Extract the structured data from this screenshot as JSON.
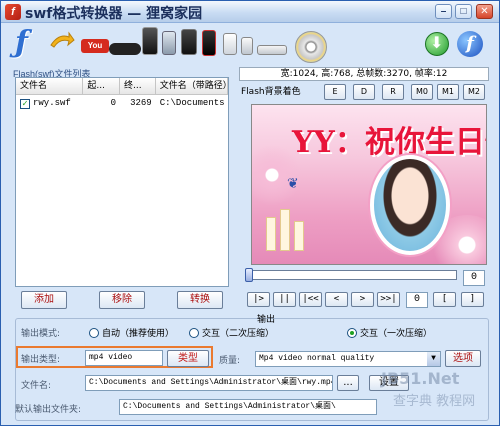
{
  "window": {
    "title": "swf格式转换器 — 狸窝家园",
    "app_icon_letter": "f",
    "controls": [
      "–",
      "□",
      "✕"
    ]
  },
  "toolbar": {
    "flash_letter": "ƒ",
    "youtube_label": "You",
    "round_flash_letter": "f",
    "icons": [
      "flash-icon",
      "arrow-icon",
      "youtube-icon",
      "psp-icon",
      "iphone-icon",
      "phone-icon",
      "ipod-icon",
      "walkman-icon",
      "ipod-classic-icon",
      "player-icon",
      "dvd-icon",
      "download-icon",
      "flash-help-icon"
    ]
  },
  "file_list": {
    "caption": "Flash(swf)文件列表",
    "headers": [
      "文件名",
      "起...",
      "终...",
      "文件名（带路径）"
    ],
    "rows": [
      {
        "name": "rwy.swf",
        "start": "0",
        "end": "3269",
        "path": "C:\\Documents"
      }
    ]
  },
  "list_buttons": {
    "add": "添加",
    "remove": "移除",
    "convert": "转换"
  },
  "preview": {
    "info": "宽:1024, 高:768, 总帧数:3270, 帧率:12",
    "bg_label": "Flash背景着色",
    "color_buttons": [
      "E",
      "D",
      "R",
      "M0",
      "M1",
      "M2"
    ],
    "title_text": "YY：祝你生日快",
    "progress": 0.0,
    "frame_counter": "0",
    "play_buttons": [
      "|>",
      "||",
      "|<<",
      "<",
      ">",
      ">>|",
      "0",
      "[",
      "]"
    ],
    "in_counter": "0"
  },
  "output": {
    "caption": "输出",
    "mode_label": "输出模式:",
    "modes": [
      {
        "label": "自动（推荐使用）",
        "selected": false
      },
      {
        "label": "交互（二次压缩）",
        "selected": false
      },
      {
        "label": "交互（一次压缩）",
        "selected": true
      }
    ],
    "type_label": "输出类型:",
    "type_value": "mp4 video",
    "type_button": "类型",
    "quality_label": "质量:",
    "quality_value": "Mp4 video normal quality",
    "options_button": "选项",
    "filename_label": "文件名:",
    "filename_value": "C:\\Documents and Settings\\Administrator\\桌面\\rwy.mp4",
    "browse_button": "...",
    "settings_button": "设置",
    "default_folder_label": "默认输出文件夹:",
    "default_folder_value": "C:\\Documents and Settings\\Administrator\\桌面\\"
  },
  "watermark": {
    "line1": "JB51.Net",
    "line2": "查字典 教程网"
  }
}
